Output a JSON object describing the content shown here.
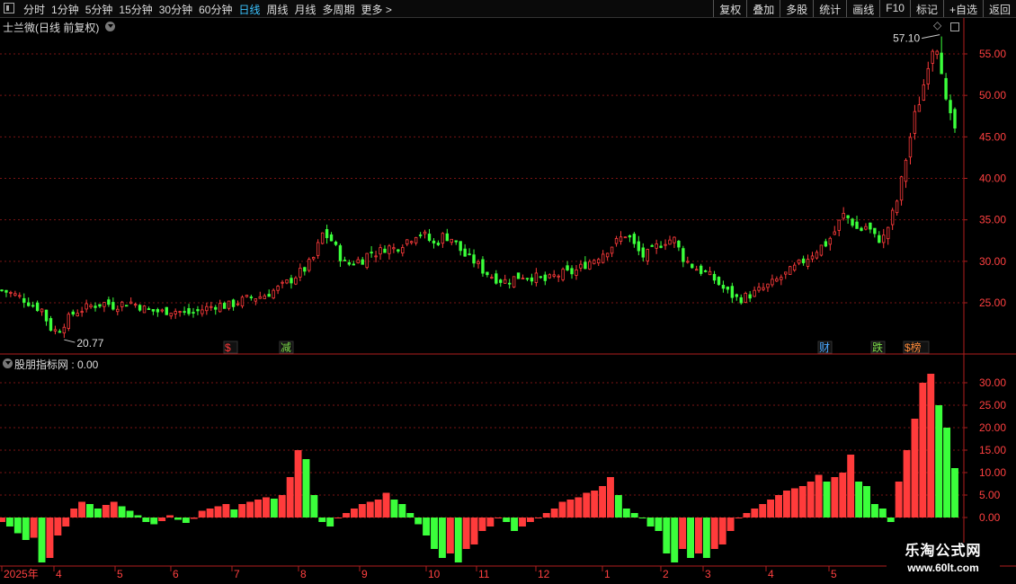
{
  "toolbar": {
    "periods": [
      "分时",
      "1分钟",
      "5分钟",
      "15分钟",
      "30分钟",
      "60分钟",
      "日线",
      "周线",
      "月线",
      "多周期",
      "更多 >"
    ],
    "active_period": "日线",
    "right_buttons": [
      "复权",
      "叠加",
      "多股",
      "统计",
      "画线",
      "F10",
      "标记",
      "+自选",
      "返回"
    ]
  },
  "main_chart": {
    "title": "士兰微(日线 前复权)",
    "y_ticks": [
      "55.00",
      "50.00",
      "45.00",
      "40.00",
      "35.00",
      "30.00",
      "25.00"
    ],
    "high_label": "57.10",
    "low_label": "20.77",
    "event_markers": [
      "$",
      "减",
      "财",
      "跌",
      "$榜"
    ]
  },
  "indicator": {
    "title": "股朋指标网 : 0.00",
    "y_ticks": [
      "30.00",
      "25.00",
      "20.00",
      "15.00",
      "10.00",
      "5.00",
      "0.00"
    ]
  },
  "time_axis": {
    "labels": [
      "2025年",
      "4",
      "5",
      "6",
      "7",
      "8",
      "9",
      "10",
      "11",
      "12",
      "1",
      "2",
      "3",
      "4",
      "5"
    ]
  },
  "watermark": {
    "line1": "乐淘公式网",
    "line2": "www.60lt.com"
  },
  "colors": {
    "up": "#ff3b3b",
    "down": "#3bff3b",
    "grid": "#7a1414",
    "axis": "#b01e1e",
    "active": "#3bc3ff",
    "marker_blue": "#4aa8ff"
  },
  "chart_data": {
    "type": "candlestick",
    "title": "士兰微(日线 前复权)",
    "ylim": [
      20,
      58
    ],
    "x_labels": [
      "2025年",
      "4",
      "5",
      "6",
      "7",
      "8",
      "9",
      "10",
      "11",
      "12",
      "1",
      "2",
      "3",
      "4",
      "5"
    ],
    "close_path": [
      26.5,
      26.2,
      25.8,
      25.3,
      24.6,
      24.2,
      22.0,
      21.5,
      22.8,
      23.8,
      24.2,
      24.6,
      24.8,
      25.0,
      24.6,
      24.9,
      25.1,
      24.7,
      24.2,
      24.0,
      23.9,
      24.1,
      24.0,
      23.7,
      23.8,
      24.2,
      24.5,
      24.8,
      24.6,
      24.9,
      25.3,
      25.6,
      25.7,
      26.0,
      26.5,
      27.0,
      27.7,
      28.5,
      29.2,
      30.5,
      33.3,
      32.8,
      31.0,
      29.5,
      30.0,
      30.2,
      31.2,
      31.0,
      31.8,
      31.5,
      32.2,
      32.8,
      33.6,
      32.9,
      32.0,
      33.0,
      33.0,
      31.7,
      30.5,
      30.0,
      29.0,
      28.3,
      27.8,
      27.6,
      28.0,
      28.3,
      28.2,
      28.0,
      27.6,
      28.2,
      28.5,
      28.6,
      29.0,
      29.8,
      30.3,
      31.0,
      31.8,
      32.5,
      33.4,
      31.8,
      30.6,
      31.0,
      32.0,
      32.6,
      32.6,
      30.5,
      29.6,
      29.0,
      28.5,
      27.8,
      26.8,
      26.0,
      25.4,
      25.8,
      26.2,
      26.7,
      27.2,
      27.9,
      28.5,
      29.2,
      30.0,
      30.8,
      31.6,
      32.2,
      33.6,
      35.6,
      35.0,
      33.6,
      34.3,
      32.9,
      32.6,
      35.0,
      38.0,
      43.0,
      47.5,
      50.8,
      55.8,
      56.2,
      48.0,
      46.0
    ],
    "indicator_values": [
      -1,
      -2,
      -3.5,
      -5,
      -4.5,
      -10,
      -9,
      -4,
      -2,
      2,
      3.5,
      3,
      2,
      2.8,
      3.5,
      2.5,
      1.5,
      0.5,
      -1,
      -1.5,
      -0.8,
      0.5,
      -0.5,
      -1.2,
      -0.3,
      1.5,
      2,
      2.5,
      3,
      1.8,
      3,
      3.5,
      4,
      4.5,
      4.2,
      5,
      9,
      15,
      13,
      5,
      -1,
      -2,
      0,
      1,
      2,
      3,
      3.5,
      4,
      5.5,
      4,
      3,
      1,
      -1.5,
      -4,
      -7,
      -9,
      -8,
      -10,
      -7,
      -6,
      -3,
      -2,
      0,
      -1,
      -3,
      -2,
      -1,
      0,
      1,
      2,
      3.5,
      4,
      4.5,
      5.5,
      6,
      7,
      9,
      5,
      2,
      1,
      0,
      -2,
      -3,
      -8,
      -10,
      -7,
      -9,
      -8,
      -9,
      -7,
      -6,
      -3,
      0,
      1,
      2,
      3,
      4,
      5,
      6,
      6.5,
      7,
      8,
      9.5,
      8,
      9,
      10,
      14,
      8,
      7,
      3,
      2,
      -1,
      8,
      15,
      22,
      30,
      32,
      25,
      20,
      11
    ]
  }
}
